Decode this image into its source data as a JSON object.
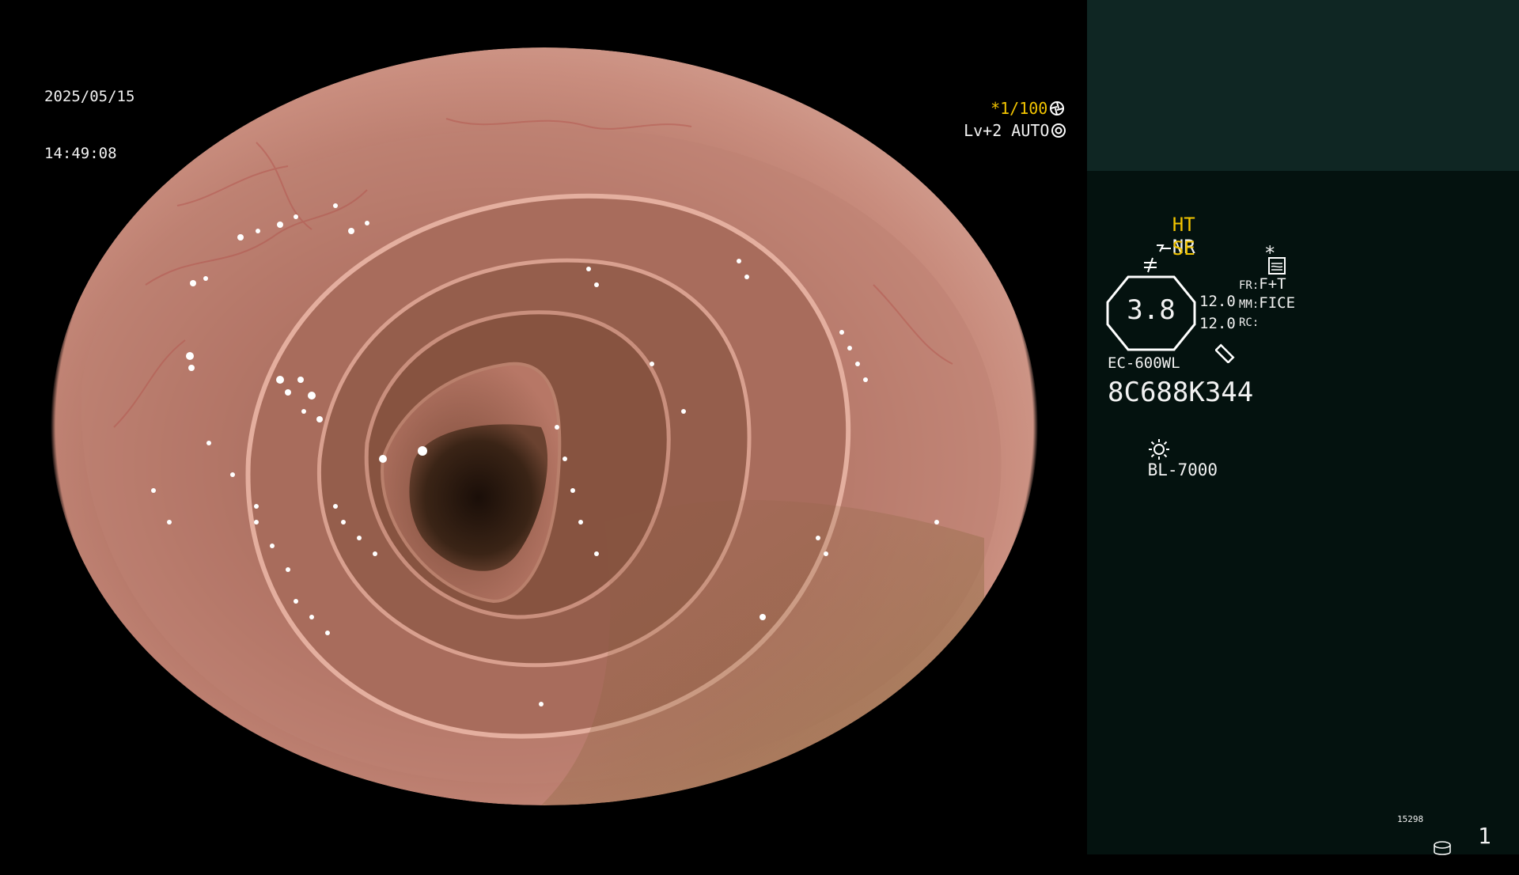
{
  "overlay": {
    "date": "2025/05/15",
    "time": "14:49:08",
    "shutter": "*1/100",
    "shutter_icon": "aperture-icon",
    "enhance": "Lv+2 AUTO",
    "auto_icon": "iris-icon"
  },
  "panel": {
    "ht": "HT",
    "nr": "NR",
    "se": "SE",
    "se_icon": "structure-enhance-icon",
    "flag_icon": "not-equal-icon",
    "chart_icon": "waveform-icon",
    "star": "*",
    "zoom": "3.8",
    "zoom_icon": "magnifier-icon",
    "val1": "12.0",
    "val2": "12.0",
    "fr_label": "FR:",
    "fr_value": "F+T",
    "mm_label": "MM:",
    "mm_value": "FICE",
    "rc_label": "RC:",
    "scope_model": "EC-600WL",
    "serial": "8C688K344",
    "light_icon": "sun-icon",
    "light_source": "BL-7000",
    "counter_small": "15298",
    "counter_icon": "disk-icon",
    "page": "1"
  },
  "colors": {
    "accent_yellow": "#f2c400",
    "panel_bg": "#04120f",
    "panel_top_bg": "#0f2623",
    "tissue": "#b5786a"
  }
}
